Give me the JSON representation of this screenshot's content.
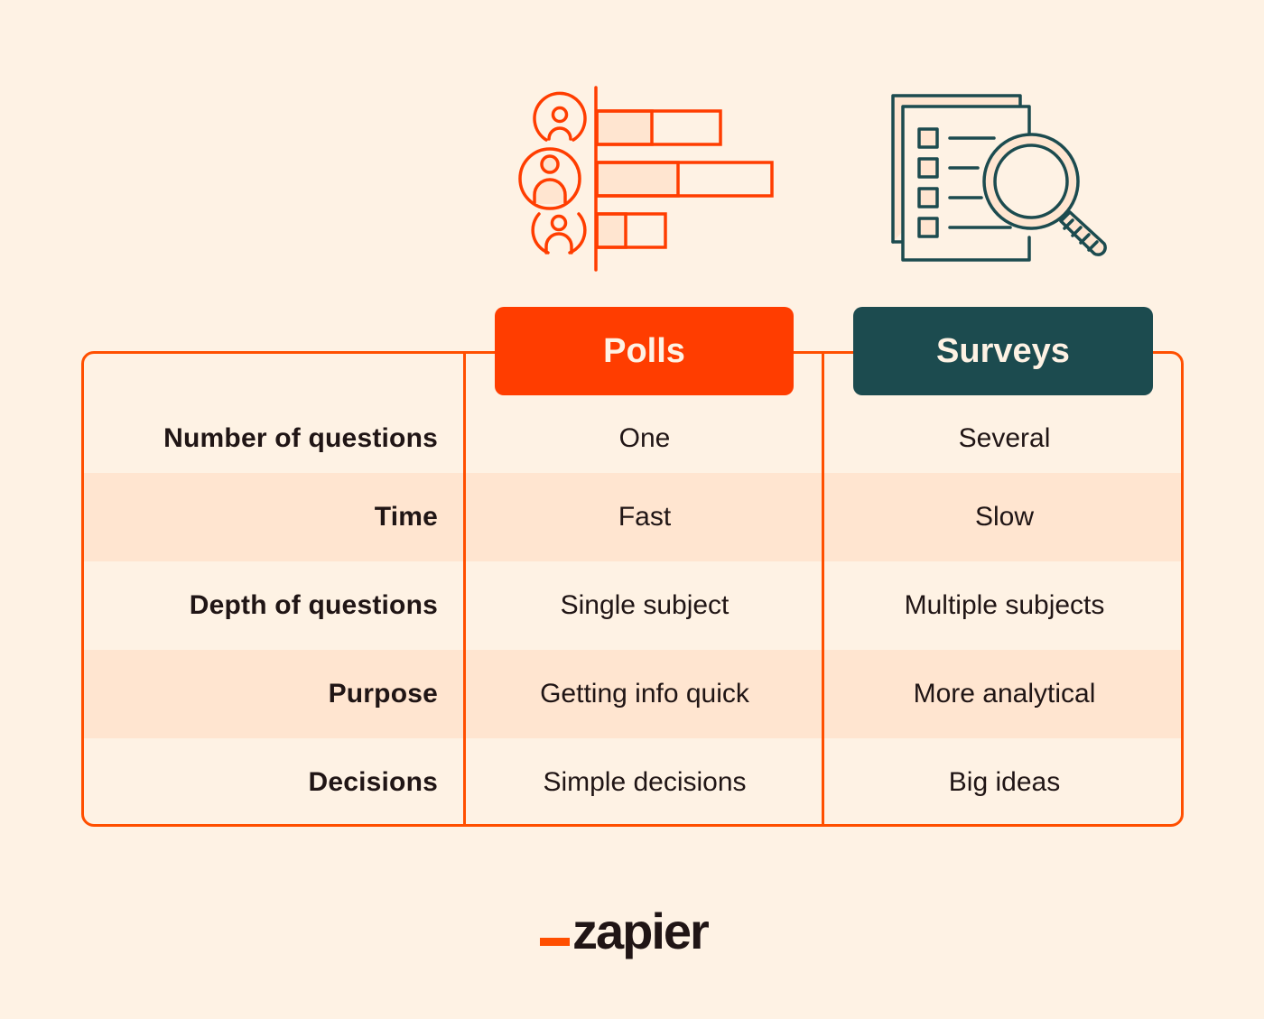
{
  "colors": {
    "background": "#fef2e4",
    "accent_orange": "#ff4f00",
    "polls_header": "#ff3d00",
    "surveys_header": "#1c4b4f",
    "alt_row": "#ffe5d0",
    "text": "#201515"
  },
  "icons": {
    "polls": "poll-bar-chart-with-people-icon",
    "surveys": "checklist-with-magnifying-glass-icon"
  },
  "headers": {
    "polls": "Polls",
    "surveys": "Surveys"
  },
  "rows": [
    {
      "label": "Number of questions",
      "polls": "One",
      "surveys": "Several"
    },
    {
      "label": "Time",
      "polls": "Fast",
      "surveys": "Slow"
    },
    {
      "label": "Depth of questions",
      "polls": "Single subject",
      "surveys": "Multiple subjects"
    },
    {
      "label": "Purpose",
      "polls": "Getting info quick",
      "surveys": "More analytical"
    },
    {
      "label": "Decisions",
      "polls": "Simple decisions",
      "surveys": "Big ideas"
    }
  ],
  "logo": {
    "text": "zapier"
  }
}
